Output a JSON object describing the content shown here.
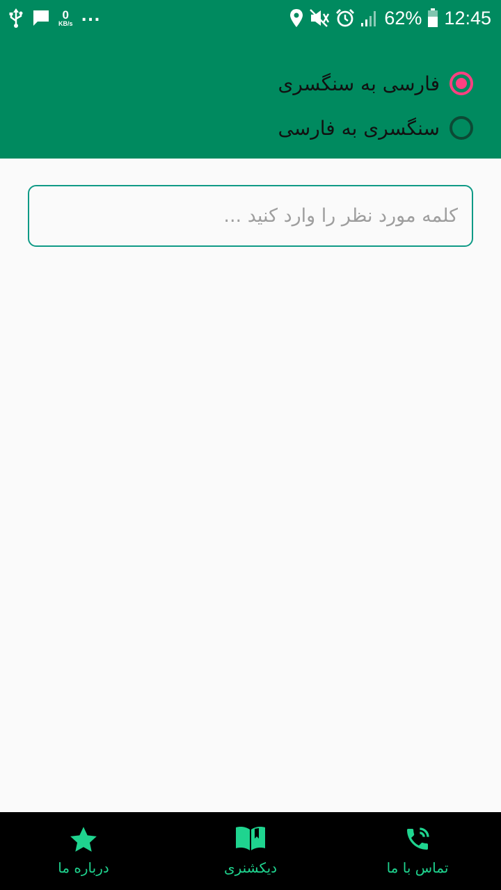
{
  "status_bar": {
    "speed_value": "0",
    "speed_unit": "KB/s",
    "more": "...",
    "battery": "62%",
    "time": "12:45",
    "icons": [
      "usb-icon",
      "message-icon",
      "location-icon",
      "mute-icon",
      "alarm-icon",
      "signal-icon",
      "battery-icon"
    ]
  },
  "direction_options": [
    {
      "label": "فارسی به سنگسری",
      "selected": true
    },
    {
      "label": "سنگسری به فارسی",
      "selected": false
    }
  ],
  "search": {
    "placeholder": "کلمه مورد نظر را وارد کنید ...",
    "value": ""
  },
  "bottom_nav": {
    "items": [
      {
        "label": "درباره ما",
        "icon": "star-icon"
      },
      {
        "label": "دیکشنری",
        "icon": "book-icon"
      },
      {
        "label": "تماس با ما",
        "icon": "phone-icon"
      }
    ]
  },
  "colors": {
    "primary": "#008a5f",
    "accent": "#ff4081",
    "nav_text": "#1fd48f",
    "nav_background": "#000000",
    "input_border": "#0f9a86"
  }
}
